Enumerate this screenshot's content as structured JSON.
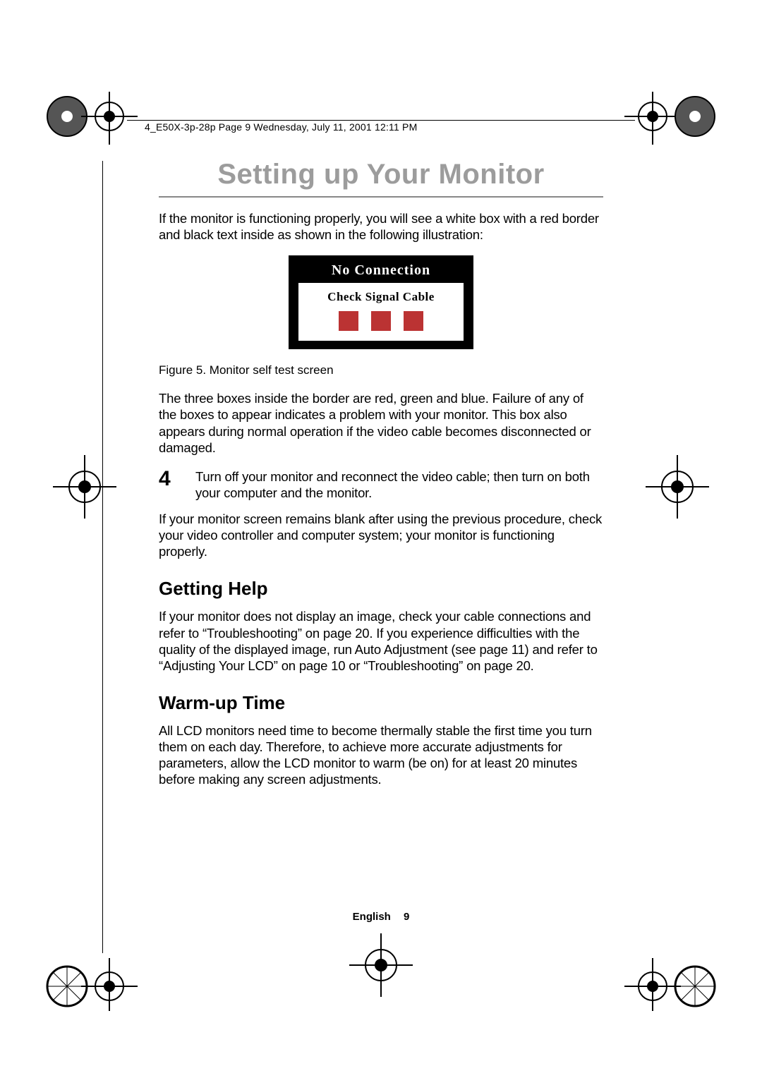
{
  "print_header": "4_E50X-3p-28p  Page 9  Wednesday, July 11, 2001  12:11 PM",
  "title": "Setting up Your Monitor",
  "intro": "If the monitor is functioning properly, you will see a white box with a red border and black text inside as shown in the following illustration:",
  "diagram": {
    "title": "No Connection",
    "subtitle": "Check Signal Cable"
  },
  "figure_caption": "Figure 5.  Monitor self test screen",
  "para_after_fig": "The three boxes inside the border are red, green and blue. Failure of any of the boxes to appear indicates a problem with your monitor. This box also appears during normal operation if the video cable becomes disconnected or damaged.",
  "step": {
    "num": "4",
    "text": "Turn off your monitor and reconnect the video cable; then turn on both your computer and the monitor."
  },
  "para_after_step": "If your monitor screen remains blank after using the previous procedure, check your video controller and computer system; your monitor is functioning properly.",
  "h2_help": "Getting Help",
  "para_help": "If your monitor does not display an image, check your cable connections and refer to “Troubleshooting” on page 20. If you experience difficulties with the quality of the displayed image, run Auto Adjustment (see page 11) and refer to “Adjusting Your LCD” on page 10 or “Troubleshooting” on page 20.",
  "h2_warm": "Warm-up Time",
  "para_warm": "All LCD monitors need time to become thermally stable the first time you turn them on each day. Therefore, to achieve more accurate adjustments for parameters, allow the LCD monitor to warm (be on) for at least 20 minutes before making any screen adjustments.",
  "footer_lang": "English",
  "footer_page": "9"
}
